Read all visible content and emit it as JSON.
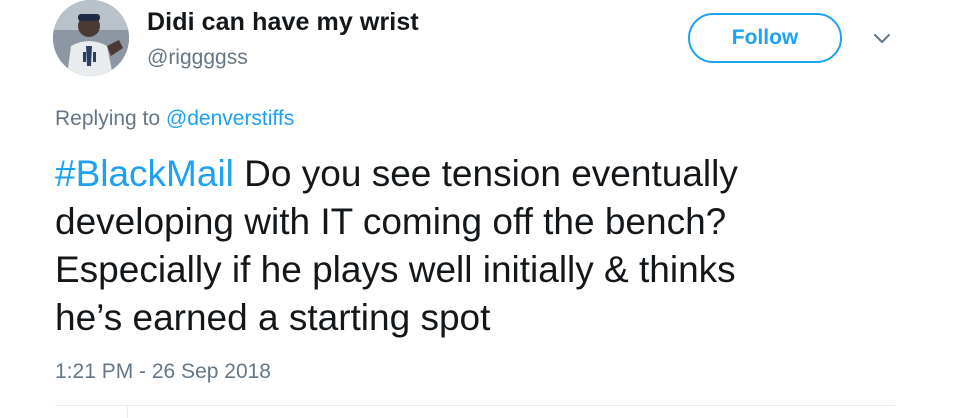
{
  "author": {
    "display_name": "Didi can have my wrist",
    "handle": "@riggggss",
    "avatar_icon": "avatar-photo"
  },
  "actions": {
    "follow_label": "Follow",
    "more_icon": "chevron-down-icon"
  },
  "reply": {
    "prefix": "Replying to",
    "mention": "@denverstiffs"
  },
  "tweet": {
    "hashtag": "#BlackMail",
    "line1_rest": " Do you see tension eventually",
    "line2": "developing with IT coming off the bench?",
    "line3": "Especially if he plays well initially & thinks",
    "line4": "he’s earned a starting spot"
  },
  "meta": {
    "timestamp": "1:21 PM - 26 Sep 2018"
  },
  "colors": {
    "accent": "#1da1f2",
    "secondary_text": "#657786",
    "primary_text": "#14171a"
  }
}
